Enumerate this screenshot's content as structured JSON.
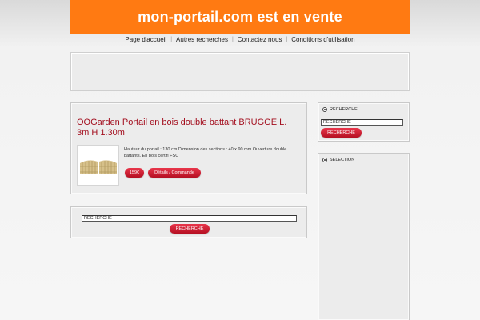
{
  "header": {
    "title": "mon-portail.com est en vente"
  },
  "nav": {
    "items": [
      {
        "label": "Page d'accueil"
      },
      {
        "label": "Autres recherches"
      },
      {
        "label": "Contactez nous"
      },
      {
        "label": "Conditions d'utilisation"
      }
    ],
    "separator": "|"
  },
  "product": {
    "title": "OOGarden Portail en bois double battant BRUGGE L. 3m H 1.30m",
    "description": "Hauteur du portail : 130 cm Dimension des sections : 40 x 90 mm Ouverture double battants. En bois certifi FSC",
    "price": "159€",
    "details_label": "Détails / Commande"
  },
  "main_search": {
    "input_value": "RECHERCHE",
    "button_label": "RECHERCHE"
  },
  "sidebar": {
    "search": {
      "heading": "RECHERCHE",
      "input_value": "RECHERCHE",
      "button_label": "RECHERCHE"
    },
    "selection": {
      "heading": "SELECTION"
    }
  },
  "colors": {
    "header_bg": "#ff7a12",
    "accent_red": "#a30e1e",
    "button_red": "#c71a2e"
  }
}
